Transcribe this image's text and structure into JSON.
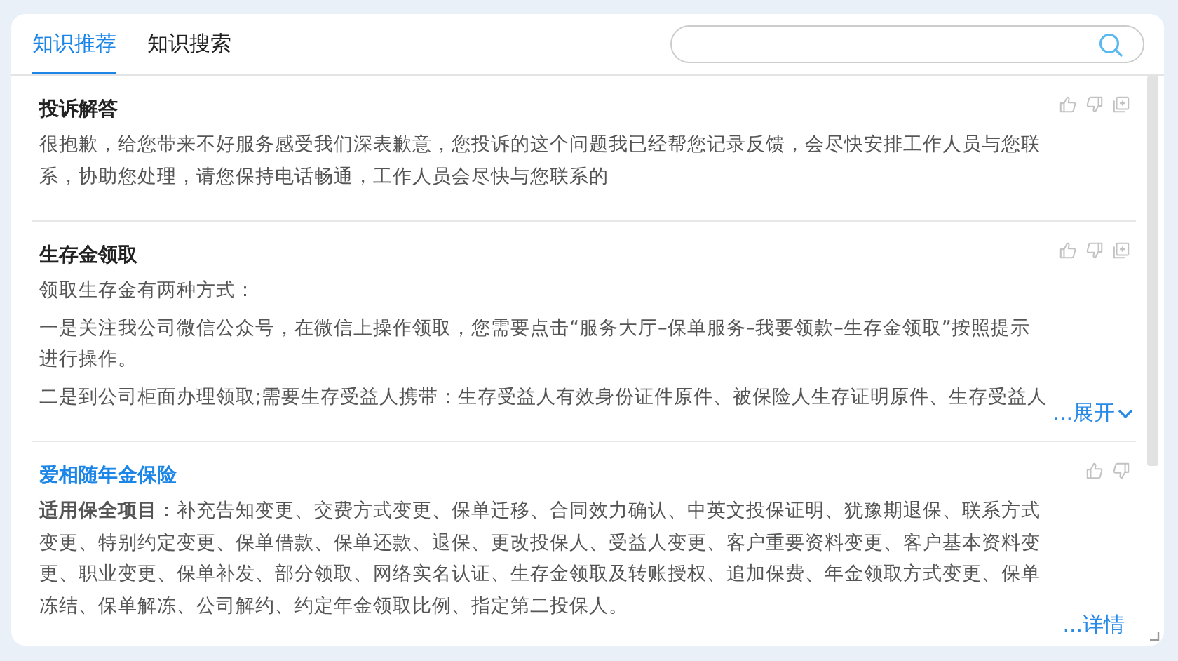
{
  "tabs": [
    {
      "label": "知识推荐",
      "selected": true
    },
    {
      "label": "知识搜索",
      "selected": false
    }
  ],
  "items": [
    {
      "kind": "answer",
      "title": "投诉解答",
      "paragraphs": [
        "很抱歉，给您带来不好服务感受我们深表歉意，您投诉的这个问题我已经帮您记录反馈，会尽快安排工作人员与您联系，协助您处理，请您保持电话畅通，工作人员会尽快与您联系的"
      ]
    },
    {
      "kind": "answer",
      "title": "生存金领取",
      "paragraphs": [
        "领取生存金有两种方式：",
        "一是关注我公司微信公众号，在微信上操作领取，您需要点击“服务大厅–保单服务–我要领款–生存金领取”按照提示进行操作。",
        "二是到公司柜面办理领取;需要生存受益人携带：生存受益人有效身份证件原件、被保险人生存证明原件、生存受益人"
      ],
      "collapsed": true,
      "expand_link": "...展开"
    },
    {
      "kind": "product",
      "title": "爱相随年金保险",
      "paragraphs": [
        "**适用保全项目**：补充告知变更、交费方式变更、保单迁移、合同效力确认、中英文投保证明、犹豫期退保、联系方式变更、特别约定变更、保单借款、保单还款、退保、更改投保人、受益人变更、客户重要资料变更、客户基本资料变更、职业变更、保单补发、部分领取、网络实名认证、生存金领取及转账授权、追加保费、年金领取方式变更、保单冻结、保单解冻、公司解约、约定年金领取比例、指定第二投保人。"
      ],
      "detail_link": "...详情"
    }
  ]
}
